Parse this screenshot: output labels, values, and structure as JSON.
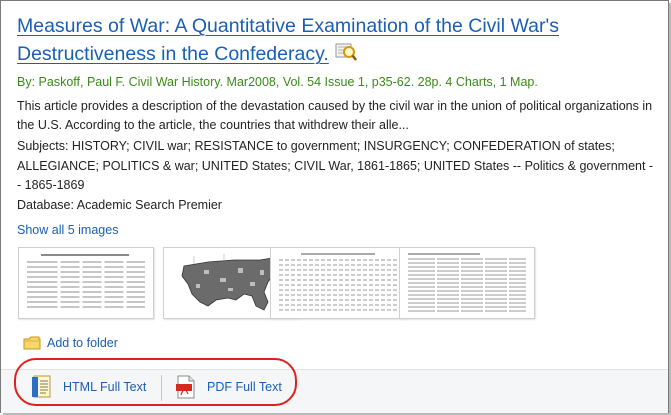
{
  "record": {
    "title": "Measures of War: A Quantitative Examination of the Civil War's Destructiveness in the Confederacy.",
    "byline": "By: Paskoff, Paul F. Civil War History. Mar2008, Vol. 54 Issue 1, p35-62. 28p. 4 Charts, 1 Map.",
    "abstract": "This article provides a description of the devastation caused by the civil war in the union of political organizations in the U.S. According to the article, the countries that withdrew their alle...",
    "subjects": "Subjects: HISTORY; CIVIL war; RESISTANCE to government; INSURGENCY; CONFEDERATION of states; ALLEGIANCE; POLITICS & war; UNITED States; CIVIL War, 1861-1865; UNITED States -- Politics & government -- 1865-1869",
    "database": "Database: Academic Search Premier",
    "show_images_label": "Show all 5 images"
  },
  "thumbnails": [
    {
      "name": "thumbnail-chart-1",
      "kind": "table"
    },
    {
      "name": "thumbnail-map",
      "kind": "map"
    },
    {
      "name": "thumbnail-chart-2",
      "kind": "table"
    },
    {
      "name": "thumbnail-chart-3",
      "kind": "table"
    }
  ],
  "actions": {
    "add_to_folder": "Add to folder",
    "html_full_text": "HTML Full Text",
    "pdf_full_text": "PDF Full Text"
  },
  "icons": {
    "preview": "magnifier-preview-icon",
    "folder": "folder-icon",
    "html": "html-document-icon",
    "pdf": "pdf-document-icon"
  },
  "colors": {
    "link": "#1a5fb4",
    "byline": "#3b8a1b",
    "highlight": "#e02020"
  }
}
